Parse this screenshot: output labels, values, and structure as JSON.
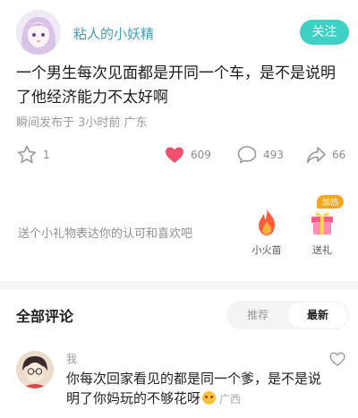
{
  "author": {
    "name": "粘人的小妖精",
    "follow_label": "关注"
  },
  "post": {
    "text": "一个男生每次见面都是开同一个车，是不是说明了他经济能力不太好啊",
    "meta": "瞬间发布于 3小时前 广东"
  },
  "actions": {
    "star_count": "1",
    "like_count": "609",
    "comment_count": "493",
    "share_count": "66"
  },
  "gifts": {
    "prompt": "送个小礼物表达你的认可和喜欢吧",
    "fire_label": "小火苗",
    "gift_label": "送礼",
    "badge": "加热"
  },
  "comments": {
    "title": "全部评论",
    "sort_hot": "推荐",
    "sort_new": "最新",
    "items": [
      {
        "name": "我",
        "text": "你每次回家看见的都是同一个爹，是不是说明了你妈玩的不够花呀",
        "location": "广西"
      }
    ]
  },
  "colors": {
    "accent": "#3fd0c5",
    "author_name": "#3e9fb6",
    "like": "#f0506e"
  }
}
